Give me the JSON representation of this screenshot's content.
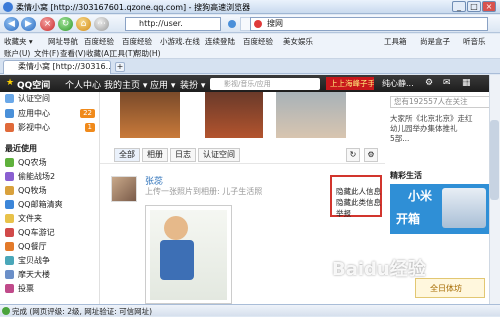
{
  "window": {
    "title": "柔情小窝 [http://303167601.qzone.qq.com] - 搜狗高速浏览器"
  },
  "address": {
    "url": "http://user.",
    "fav_label": "收藏",
    "search_value": "搜网"
  },
  "favbar": {
    "items": [
      "收藏夹 ▾",
      "网址导航",
      "百度经验",
      "百度经验",
      "小游戏.在线",
      "连续登陆",
      "百度经验",
      "美女娱乐"
    ],
    "tools_label": "工具箱",
    "mail_label": "尚是盒子",
    "music_label": "听音乐"
  },
  "menubar": {
    "items": [
      "账户(U)",
      "文件(F)",
      "查看(V)",
      "收藏(A)",
      "工具(T)",
      "帮助(H)"
    ]
  },
  "tabs": {
    "active_label": "柔情小窝 [http://30316..."
  },
  "qzone": {
    "logo": "QQ空间",
    "nav": [
      "个人中心",
      "我的主页 ▾",
      "应用 ▾",
      "装扮 ▾"
    ],
    "search_placeholder": "影视/音乐/应用",
    "promo": "上上海峰子手",
    "user": "纯心静..."
  },
  "sidebar": {
    "items": [
      {
        "label": "认证空间",
        "badge": ""
      },
      {
        "label": "应用中心",
        "badge": "22"
      },
      {
        "label": "影视中心",
        "badge": "1"
      }
    ],
    "recent_title": "最近使用",
    "recent": [
      "QQ农场",
      "偷能战场2",
      "QQ牧场",
      "QQ邮箱清爽",
      "文件夹",
      "QQ车游记",
      "QQ餐厅",
      "宝贝战争",
      "摩天大楼",
      "投票"
    ]
  },
  "feed": {
    "filters": [
      "全部",
      "相册",
      "日志",
      "认证空间"
    ],
    "user_name": "张蕊",
    "update_text": "上传一张照片到相册: 儿子生活照"
  },
  "dropdown": {
    "items": [
      "隐藏此人信息",
      "隐藏此类信息",
      "举报"
    ]
  },
  "right": {
    "search_text": "您有192557人在关注",
    "news": [
      "大家所《北京北京》走红",
      "幼儿园举办集体推礼",
      "5部..."
    ],
    "rec_title": "精彩生活",
    "ad_line1": "小米",
    "ad_line2": "开箱",
    "ad2_label": "全日体坊"
  },
  "status": {
    "text": "完成 (网页评级: 2级, 网址验证: 可信网址)"
  },
  "watermark": "Baidu经验"
}
